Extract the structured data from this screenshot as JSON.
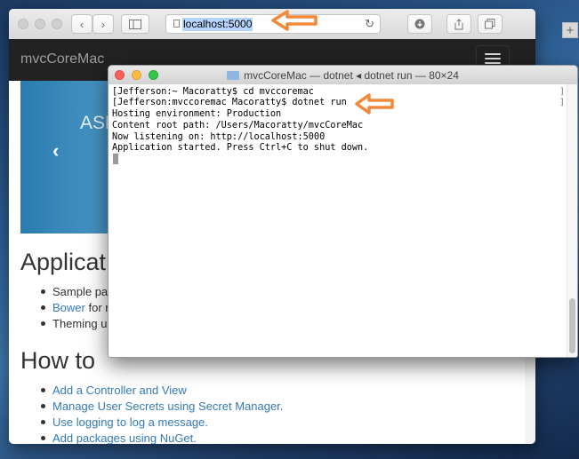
{
  "browser": {
    "url": "localhost:5000"
  },
  "app": {
    "brand": "mvcCoreMac",
    "carousel_text": "ASP",
    "carousel_prev": "‹",
    "sections": [
      {
        "heading": "Applicat",
        "items": [
          "Sample pag",
          "Bower for r",
          "Theming us"
        ]
      },
      {
        "heading": "How to",
        "items": [
          "Add a Controller and View",
          "Manage User Secrets using Secret Manager.",
          "Use logging to log a message.",
          "Add packages using NuGet."
        ]
      }
    ],
    "bower_link": "Bower",
    "bower_rest": " for r"
  },
  "terminal": {
    "title": "mvcCoreMac — dotnet ◂ dotnet run — 80×24",
    "lines": [
      "[Jefferson:~ Macoratty$ cd mvccoremac",
      "[Jefferson:mvccoremac Macoratty$ dotnet run",
      "Hosting environment: Production",
      "Content root path: /Users/Macoratty/mvcCoreMac",
      "Now listening on: http://localhost:5000",
      "Application started. Press Ctrl+C to shut down."
    ]
  },
  "colors": {
    "arrow": "#f2893a",
    "link": "#337ab7",
    "navbar": "#222222"
  },
  "icons": [
    "back-icon",
    "forward-icon",
    "sidebar-icon",
    "reload-icon",
    "download-icon",
    "share-icon",
    "tabs-icon",
    "new-tab-icon",
    "hamburger-icon",
    "folder-icon"
  ]
}
